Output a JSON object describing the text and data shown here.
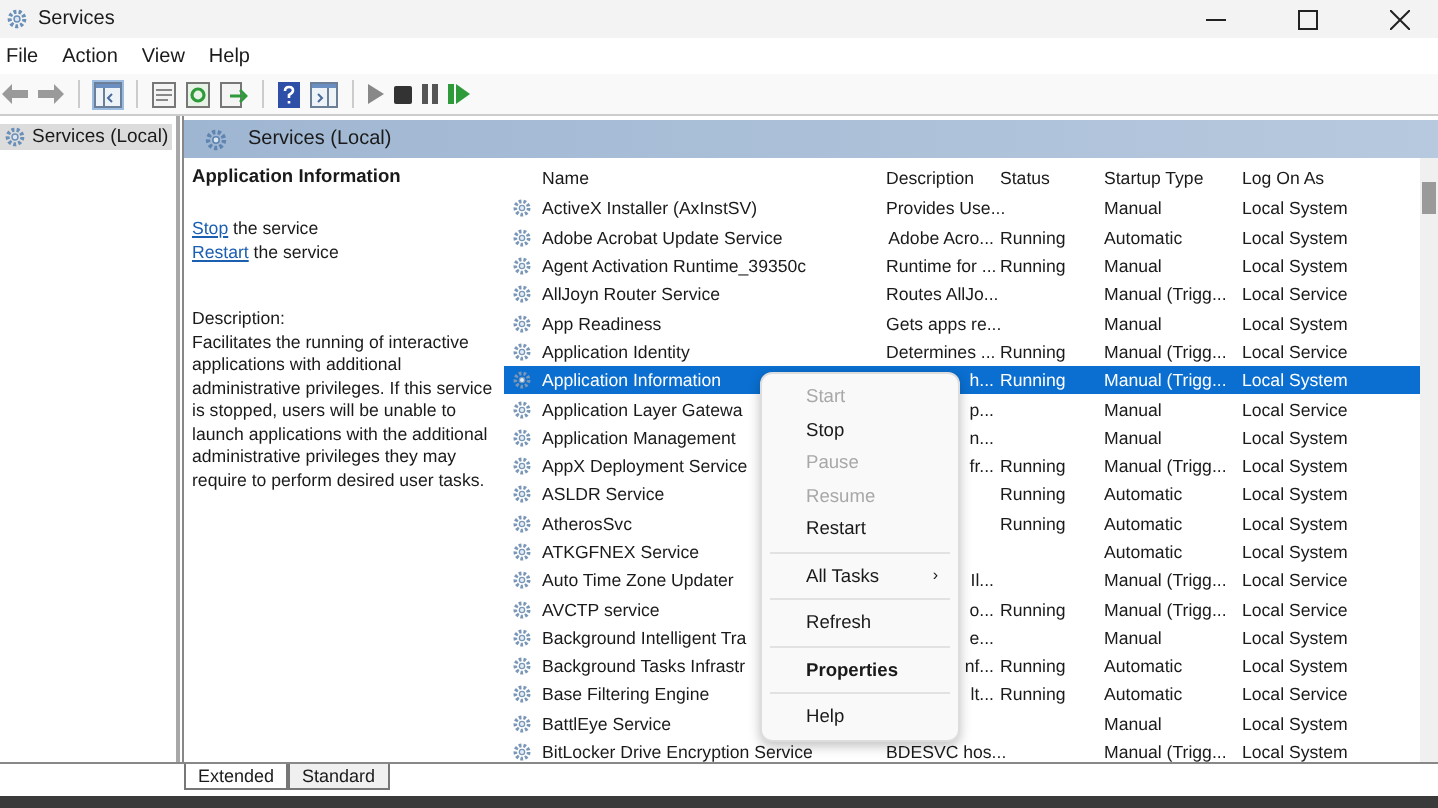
{
  "window": {
    "title": "Services"
  },
  "menu": [
    "File",
    "Action",
    "View",
    "Help"
  ],
  "tree": {
    "items": [
      {
        "label": "Services (Local)",
        "selected": true
      }
    ]
  },
  "header": {
    "title": "Services (Local)"
  },
  "details": {
    "title": "Application Information",
    "actions": [
      {
        "link": "Stop",
        "text": " the service"
      },
      {
        "link": "Restart",
        "text": " the service"
      }
    ],
    "description_label": "Description:",
    "description": "Facilitates the running of interactive applications with additional administrative privileges.  If this service is stopped, users will be unable to launch applications with the additional administrative privileges they may require to perform desired user tasks."
  },
  "table": {
    "columns": [
      "Name",
      "Description",
      "Status",
      "Startup Type",
      "Log On As"
    ],
    "rows": [
      {
        "name": "ActiveX Installer (AxInstSV)",
        "description": "Provides Use...",
        "status": "",
        "startup": "Manual",
        "logon": "Local System",
        "selected": false
      },
      {
        "name": "Adobe Acrobat Update Service",
        "description": "Adobe Acro...",
        "status": "Running",
        "startup": "Automatic",
        "logon": "Local System",
        "selected": false
      },
      {
        "name": "Agent Activation Runtime_39350c",
        "description": "Runtime for ...",
        "status": "Running",
        "startup": "Manual",
        "logon": "Local System",
        "selected": false
      },
      {
        "name": "AllJoyn Router Service",
        "description": "Routes AllJo...",
        "status": "",
        "startup": "Manual (Trigg...",
        "logon": "Local Service",
        "selected": false
      },
      {
        "name": "App Readiness",
        "description": "Gets apps re...",
        "status": "",
        "startup": "Manual",
        "logon": "Local System",
        "selected": false
      },
      {
        "name": "Application Identity",
        "description": "Determines ...",
        "status": "Running",
        "startup": "Manual (Trigg...",
        "logon": "Local Service",
        "selected": false
      },
      {
        "name": "Application Information",
        "description": "h...",
        "status": "Running",
        "startup": "Manual (Trigg...",
        "logon": "Local System",
        "selected": true
      },
      {
        "name": "Application Layer Gatewa",
        "description": "p...",
        "status": "",
        "startup": "Manual",
        "logon": "Local Service",
        "selected": false
      },
      {
        "name": "Application Management",
        "description": "n...",
        "status": "",
        "startup": "Manual",
        "logon": "Local System",
        "selected": false
      },
      {
        "name": "AppX Deployment Service",
        "description": "fr...",
        "status": "Running",
        "startup": "Manual (Trigg...",
        "logon": "Local System",
        "selected": false
      },
      {
        "name": "ASLDR Service",
        "description": "",
        "status": "Running",
        "startup": "Automatic",
        "logon": "Local System",
        "selected": false
      },
      {
        "name": "AtherosSvc",
        "description": "",
        "status": "Running",
        "startup": "Automatic",
        "logon": "Local System",
        "selected": false
      },
      {
        "name": "ATKGFNEX Service",
        "description": "",
        "status": "",
        "startup": "Automatic",
        "logon": "Local System",
        "selected": false
      },
      {
        "name": "Auto Time Zone Updater",
        "description": "Il...",
        "status": "",
        "startup": "Manual (Trigg...",
        "logon": "Local Service",
        "selected": false
      },
      {
        "name": "AVCTP service",
        "description": "o...",
        "status": "Running",
        "startup": "Manual (Trigg...",
        "logon": "Local Service",
        "selected": false
      },
      {
        "name": "Background Intelligent Tra",
        "description": "e...",
        "status": "",
        "startup": "Manual",
        "logon": "Local System",
        "selected": false
      },
      {
        "name": "Background Tasks Infrastr",
        "description": "nf...",
        "status": "Running",
        "startup": "Automatic",
        "logon": "Local System",
        "selected": false
      },
      {
        "name": "Base Filtering Engine",
        "description": "lt...",
        "status": "Running",
        "startup": "Automatic",
        "logon": "Local Service",
        "selected": false
      },
      {
        "name": "BattlEye Service",
        "description": "",
        "status": "",
        "startup": "Manual",
        "logon": "Local System",
        "selected": false
      },
      {
        "name": "BitLocker Drive Encryption Service",
        "description": "BDESVC hos...",
        "status": "",
        "startup": "Manual (Trigg...",
        "logon": "Local System",
        "selected": false
      }
    ]
  },
  "context_menu": [
    {
      "label": "Start",
      "disabled": true,
      "bold": false,
      "separator_after": false
    },
    {
      "label": "Stop",
      "disabled": false,
      "bold": false,
      "separator_after": false
    },
    {
      "label": "Pause",
      "disabled": true,
      "bold": false,
      "separator_after": false
    },
    {
      "label": "Resume",
      "disabled": true,
      "bold": false,
      "separator_after": false
    },
    {
      "label": "Restart",
      "disabled": false,
      "bold": false,
      "separator_after": true
    },
    {
      "label": "All Tasks",
      "arrow": "›",
      "disabled": false,
      "bold": false,
      "separator_after": true
    },
    {
      "label": "Refresh",
      "disabled": false,
      "bold": false,
      "separator_after": true
    },
    {
      "label": "Properties",
      "disabled": false,
      "bold": true,
      "separator_after": true
    },
    {
      "label": "Help",
      "disabled": false,
      "bold": false,
      "separator_after": false
    }
  ],
  "tabs": [
    {
      "label": "Extended",
      "selected": true
    },
    {
      "label": "Standard",
      "selected": false
    }
  ]
}
